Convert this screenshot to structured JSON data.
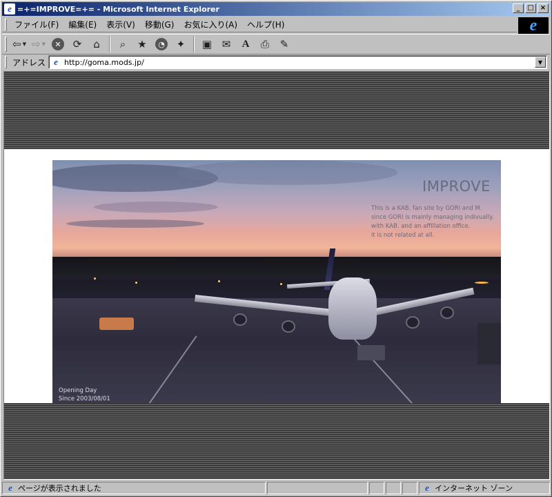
{
  "window": {
    "title": "=+=IMPROVE=+= - Microsoft Internet Explorer",
    "minimize_label": "_",
    "maximize_label": "□",
    "close_label": "×"
  },
  "menubar": {
    "items": [
      {
        "label": "ファイル(F)"
      },
      {
        "label": "編集(E)"
      },
      {
        "label": "表示(V)"
      },
      {
        "label": "移動(G)"
      },
      {
        "label": "お気に入り(A)"
      },
      {
        "label": "ヘルプ(H)"
      }
    ]
  },
  "toolbar": {
    "icons": {
      "back": "back-arrow-icon",
      "forward": "forward-arrow-icon",
      "stop": "stop-icon",
      "refresh": "refresh-icon",
      "home": "home-icon",
      "search": "search-icon",
      "favorites": "favorites-icon",
      "history": "history-icon",
      "channels": "channels-icon",
      "fullscreen": "fullscreen-icon",
      "mail": "mail-icon",
      "font": "font-icon",
      "print": "print-icon",
      "edit": "edit-icon"
    }
  },
  "address": {
    "label": "アドレス",
    "url": "http://goma.mods.jp/"
  },
  "page": {
    "title": "IMPROVE",
    "description": [
      "This is a KAB. fan site by GORI and M.",
      "since GORI is mainly managing indivually.",
      "with KAB. and an affillation office.",
      "it is not related at all."
    ],
    "opening_label": "Opening Day",
    "since_label": "Since 2003/08/01"
  },
  "status": {
    "text": "ページが表示されました",
    "zone": "インターネット ゾーン"
  },
  "colors": {
    "titlebar_start": "#0a246a",
    "titlebar_end": "#a6caf0",
    "chrome": "#c0c0c0",
    "hero_title": "#6a6a7c"
  }
}
